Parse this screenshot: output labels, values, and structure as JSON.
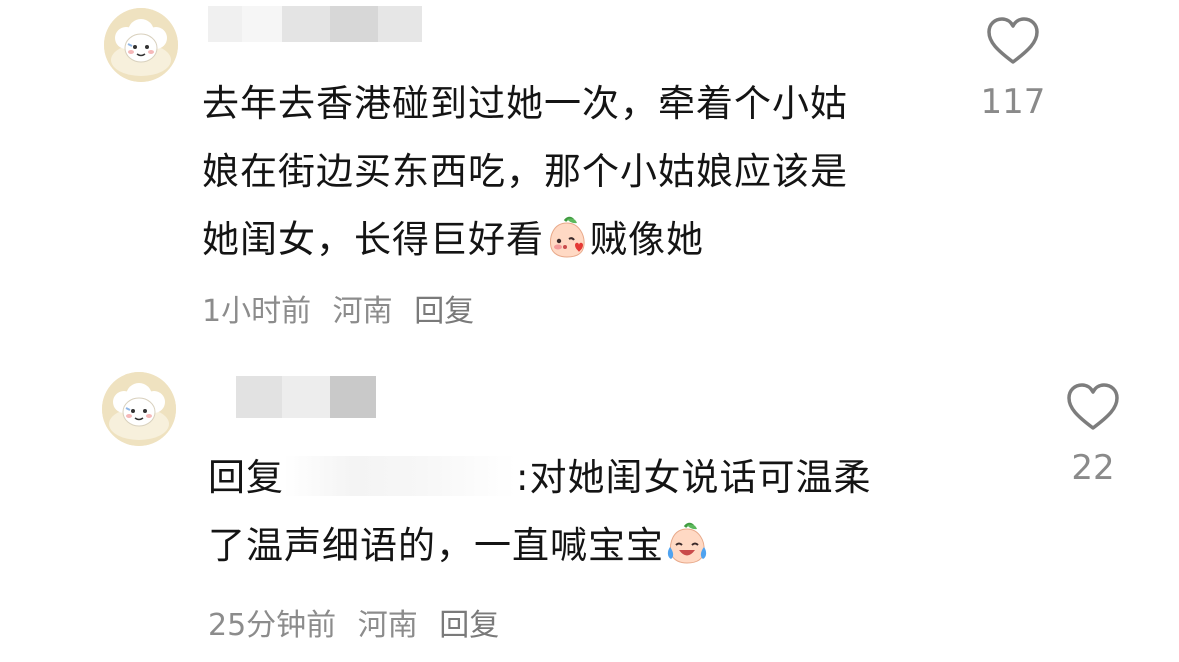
{
  "comments": [
    {
      "lines": [
        "去年去香港碰到过她一次，牵着个小姑",
        "娘在街边买东西吃，那个小姑娘应该是",
        "她闺女，长得巨好看"
      ],
      "line3_suffix": "贼像她",
      "emoji": "blushing-peach-emoji",
      "time": "1小时前",
      "location": "河南",
      "reply_label": "回复",
      "likes": "117"
    },
    {
      "prefix": "回复",
      "line1_text": ":对她闺女说话可温柔",
      "line2_text": "了温声细语的，一直喊宝宝",
      "emoji": "crying-laughing-peach-emoji",
      "time": "25分钟前",
      "location": "河南",
      "reply_label": "回复",
      "likes": "22"
    }
  ],
  "icons": {
    "like": "heart-outline-icon",
    "avatar": "cartoon-sheep-avatar"
  },
  "colors": {
    "text": "#141414",
    "meta": "#8c8c8c",
    "heart_stroke": "#7d7d7d"
  }
}
